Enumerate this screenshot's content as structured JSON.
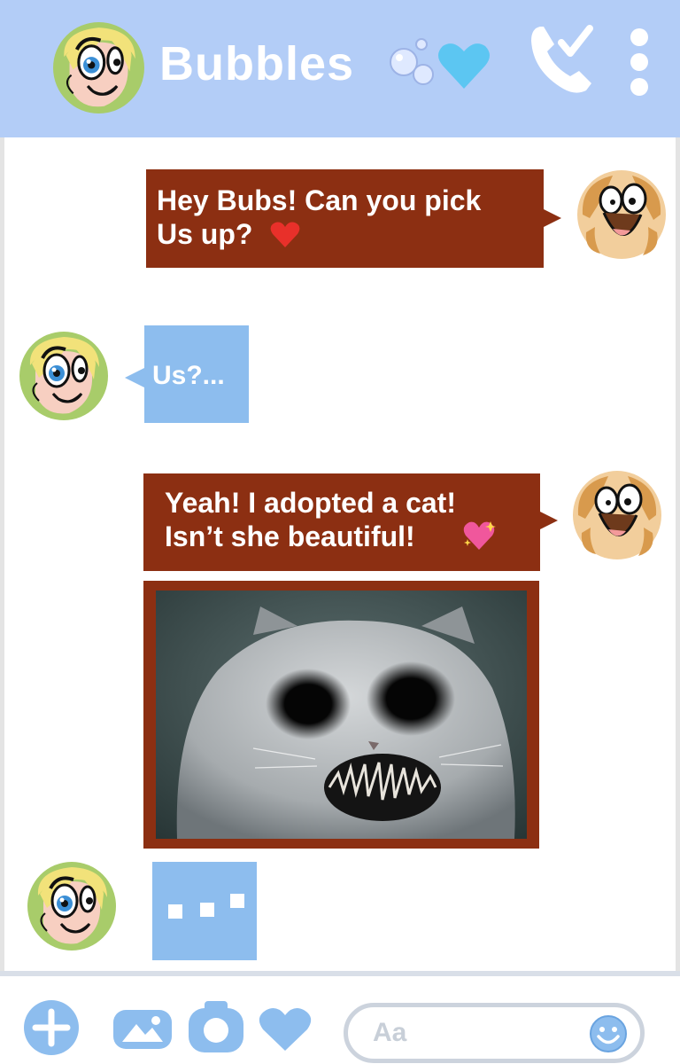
{
  "header": {
    "contact_name": "Bubbles",
    "title_emoji": "bubbles-and-blue-heart",
    "call_icon": "phone-check-icon",
    "menu_icon": "vertical-dots-icon"
  },
  "messages": [
    {
      "sender": "me",
      "text": "Hey Bubs! Can you pick\nUs up?",
      "emoji": "red-heart"
    },
    {
      "sender": "bubbles",
      "text": "Us?..."
    },
    {
      "sender": "me",
      "text": "Yeah! I adopted a cat!\nIsn’t she beautiful!",
      "emoji": "sparkling-heart"
    },
    {
      "sender": "me",
      "type": "image",
      "content": "cat-photo"
    },
    {
      "sender": "bubbles",
      "type": "typing"
    }
  ],
  "composer": {
    "placeholder": "Aa",
    "icons": [
      "plus-icon",
      "gallery-icon",
      "camera-icon",
      "heart-icon",
      "smiley-icon"
    ]
  },
  "colors": {
    "header_bg": "#b3cdf7",
    "outgoing_bubble": "#8c2f12",
    "incoming_bubble": "#8dbdee",
    "icon_blue": "#8dbdee"
  }
}
